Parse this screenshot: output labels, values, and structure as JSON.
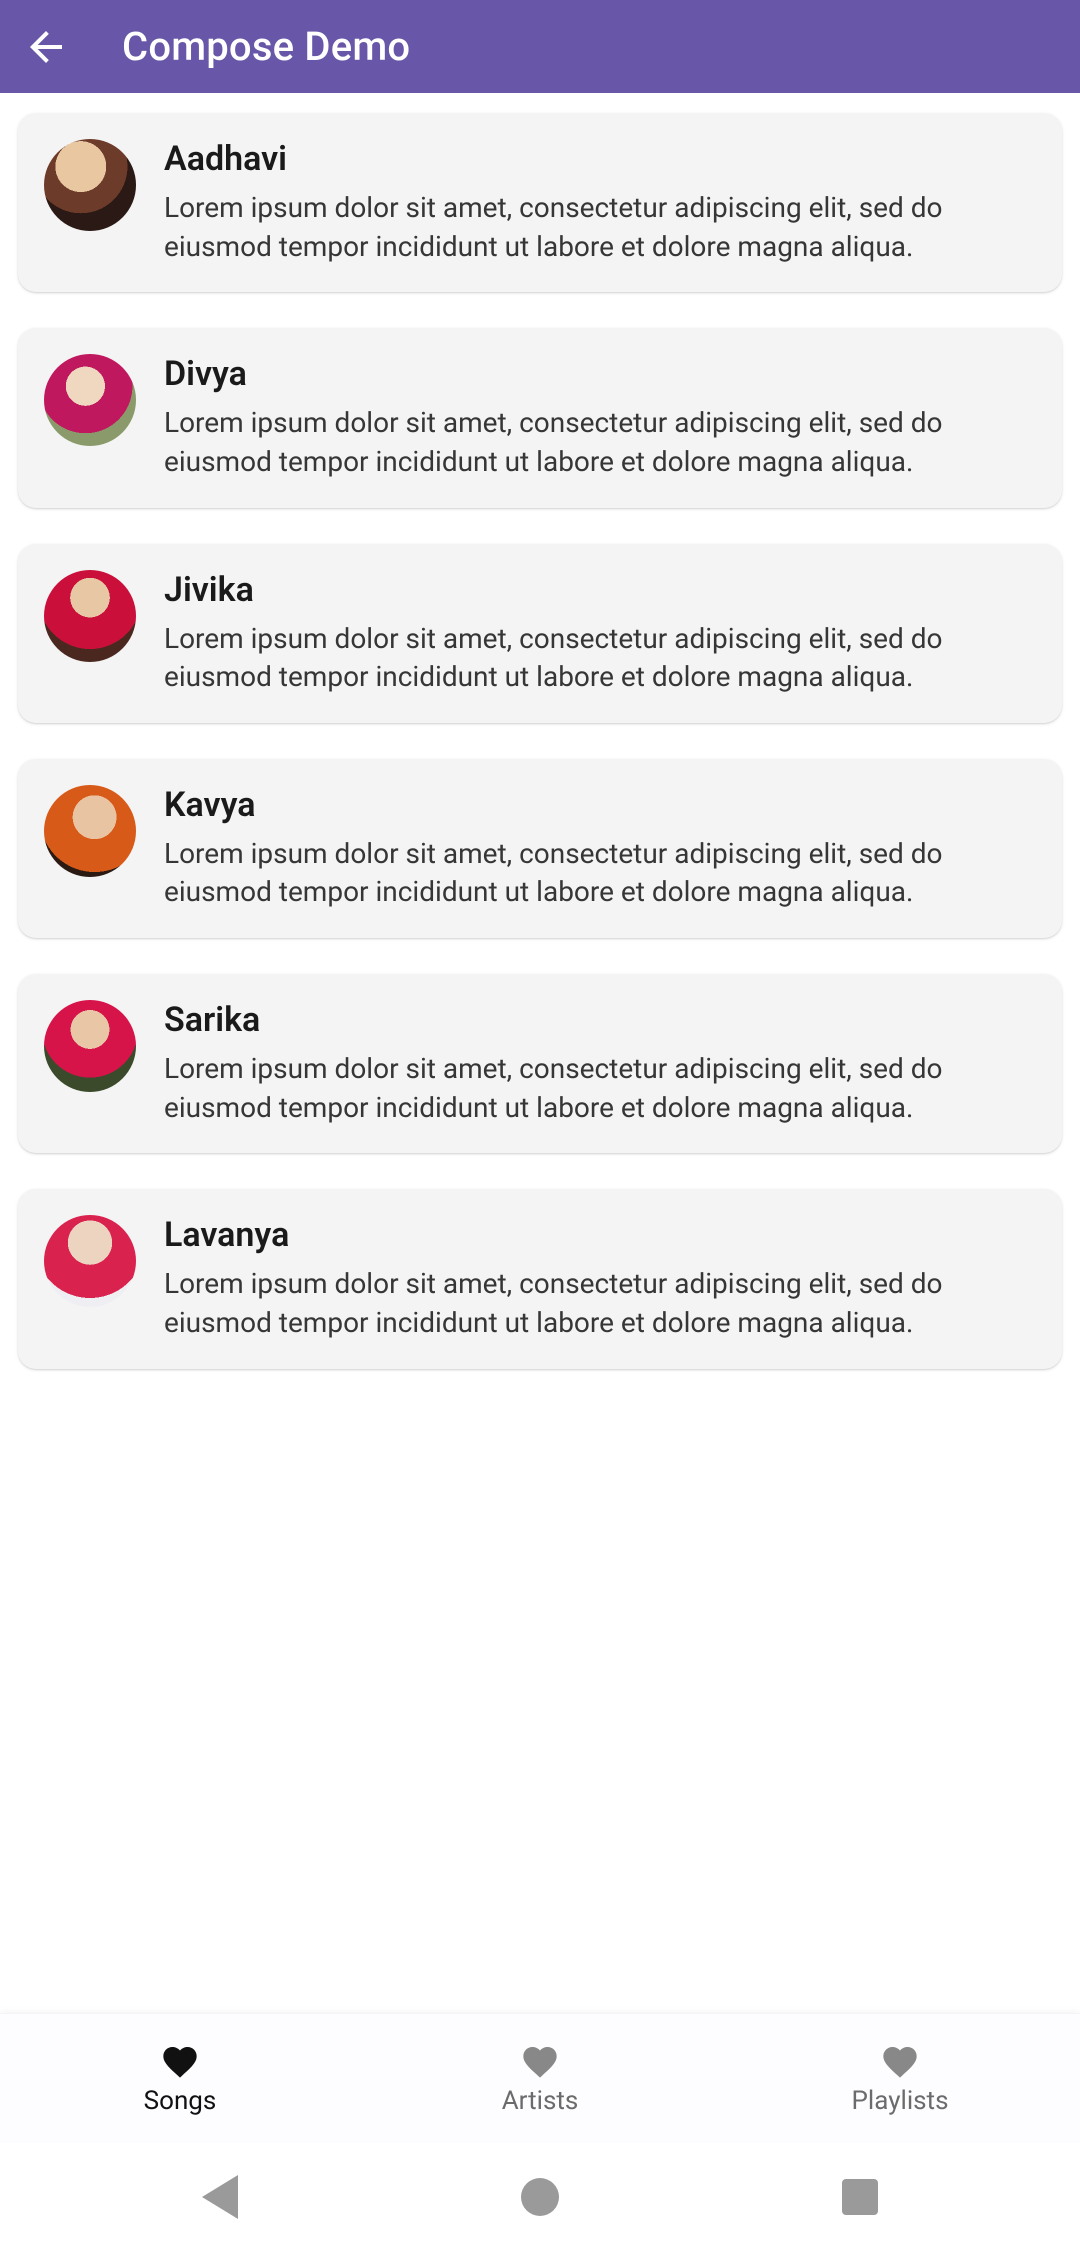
{
  "appbar": {
    "title": "Compose Demo",
    "back_desc": "Back"
  },
  "items": [
    {
      "name": "Aadhavi",
      "desc": "Lorem ipsum dolor sit amet, consectetur adipiscing elit, sed do eiusmod tempor incididunt ut labore et dolore magna aliqua."
    },
    {
      "name": "Divya",
      "desc": "Lorem ipsum dolor sit amet, consectetur adipiscing elit, sed do eiusmod tempor incididunt ut labore et dolore magna aliqua."
    },
    {
      "name": "Jivika",
      "desc": "Lorem ipsum dolor sit amet, consectetur adipiscing elit, sed do eiusmod tempor incididunt ut labore et dolore magna aliqua."
    },
    {
      "name": "Kavya",
      "desc": "Lorem ipsum dolor sit amet, consectetur adipiscing elit, sed do eiusmod tempor incididunt ut labore et dolore magna aliqua."
    },
    {
      "name": "Sarika",
      "desc": "Lorem ipsum dolor sit amet, consectetur adipiscing elit, sed do eiusmod tempor incididunt ut labore et dolore magna aliqua."
    },
    {
      "name": "Lavanya",
      "desc": "Lorem ipsum dolor sit amet, consectetur adipiscing elit, sed do eiusmod tempor incididunt ut labore et dolore magna aliqua."
    }
  ],
  "bottomnav": {
    "items": [
      {
        "label": "Songs",
        "icon": "heart",
        "active": true
      },
      {
        "label": "Artists",
        "icon": "heart",
        "active": false
      },
      {
        "label": "Playlists",
        "icon": "heart",
        "active": false
      }
    ]
  }
}
